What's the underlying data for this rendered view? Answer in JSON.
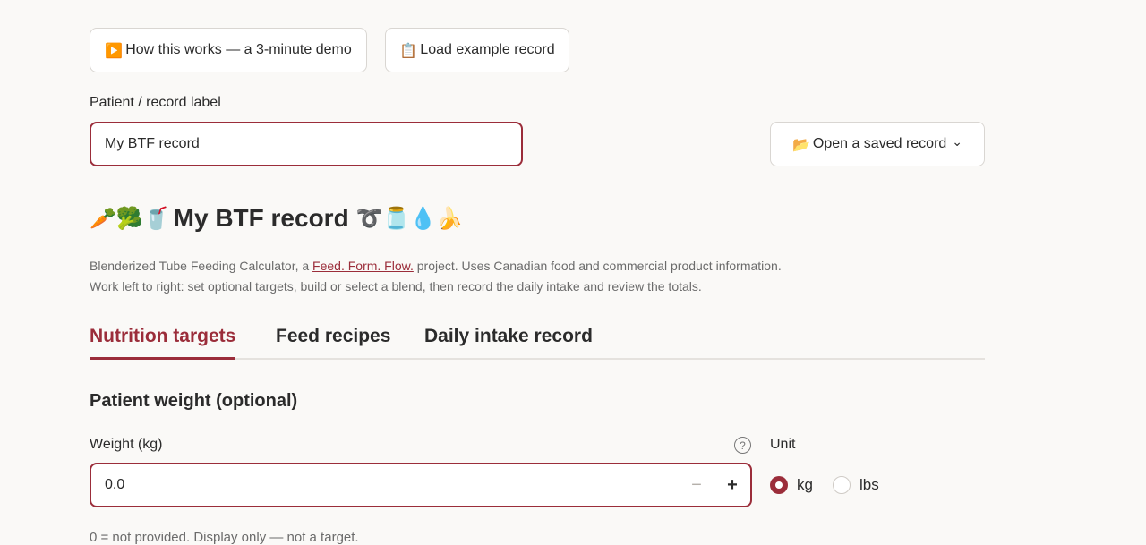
{
  "toolbar": {
    "demo_icon": "▶️",
    "demo_label": "How this works — a 3-minute demo",
    "example_icon": "📋",
    "example_label": "Load example record"
  },
  "record": {
    "label": "Patient / record label",
    "value": "My BTF record",
    "open_icon": "📂",
    "open_label": "Open a saved record",
    "open_chevron": "⌄"
  },
  "header": {
    "emoji_left": "🥕🥦🥤",
    "title": "My BTF record",
    "emoji_right": "➰🫙💧🍌",
    "desc_prefix": "Blenderized Tube Feeding Calculator, a ",
    "desc_link": "Feed. Form. Flow.",
    "desc_suffix": " project. Uses Canadian food and commercial product information.",
    "desc_line2": "Work left to right: set optional targets, build or select a blend, then record the daily intake and review the totals."
  },
  "tabs": [
    {
      "label": "Nutrition targets",
      "active": true
    },
    {
      "label": "Feed recipes",
      "active": false
    },
    {
      "label": "Daily intake record",
      "active": false
    }
  ],
  "weight": {
    "section_title": "Patient weight (optional)",
    "field_label": "Weight (kg)",
    "help_glyph": "?",
    "value": "0.0",
    "minus": "−",
    "plus": "+",
    "unit_label": "Unit",
    "units": [
      "kg",
      "lbs"
    ],
    "selected_unit": "kg",
    "note": "0 = not provided. Display only — not a target."
  },
  "colors": {
    "accent": "#9b2d3a",
    "background": "#faf9f7",
    "muted_text": "#6b6b6b"
  }
}
